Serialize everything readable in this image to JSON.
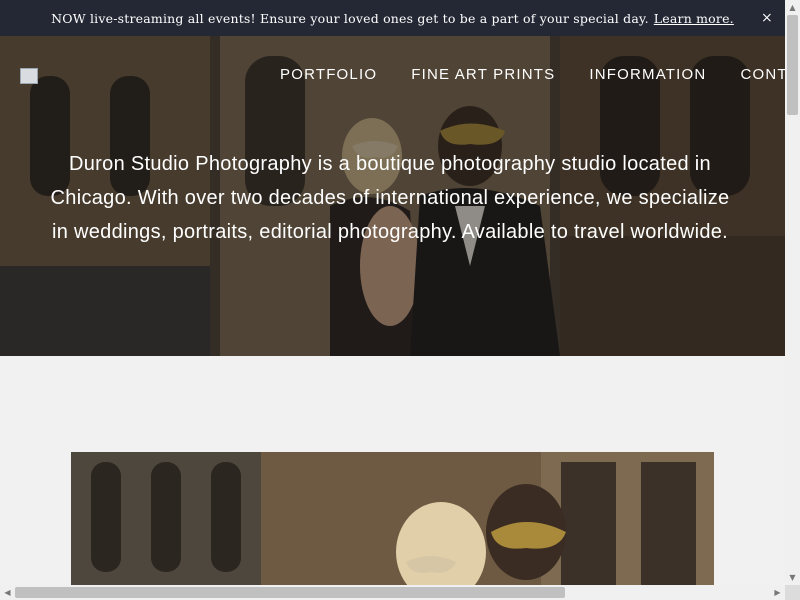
{
  "announcement": {
    "message": "NOW live-streaming all events! Ensure your loved ones get to be a part of your special day.",
    "link_label": "Learn more.",
    "close_label": "×"
  },
  "nav": {
    "items": [
      "PORTFOLIO",
      "FINE ART PRINTS",
      "INFORMATION",
      "CONTA"
    ]
  },
  "hero": {
    "tagline": "Duron Studio Photography is a boutique photography studio located in Chicago. With over two decades of international experience, we specialize in weddings, portraits, editorial photography. Available to travel worldwide."
  },
  "scrollbars": {
    "up_glyph": "▲",
    "down_glyph": "▼",
    "left_glyph": "◀",
    "right_glyph": "▶"
  }
}
